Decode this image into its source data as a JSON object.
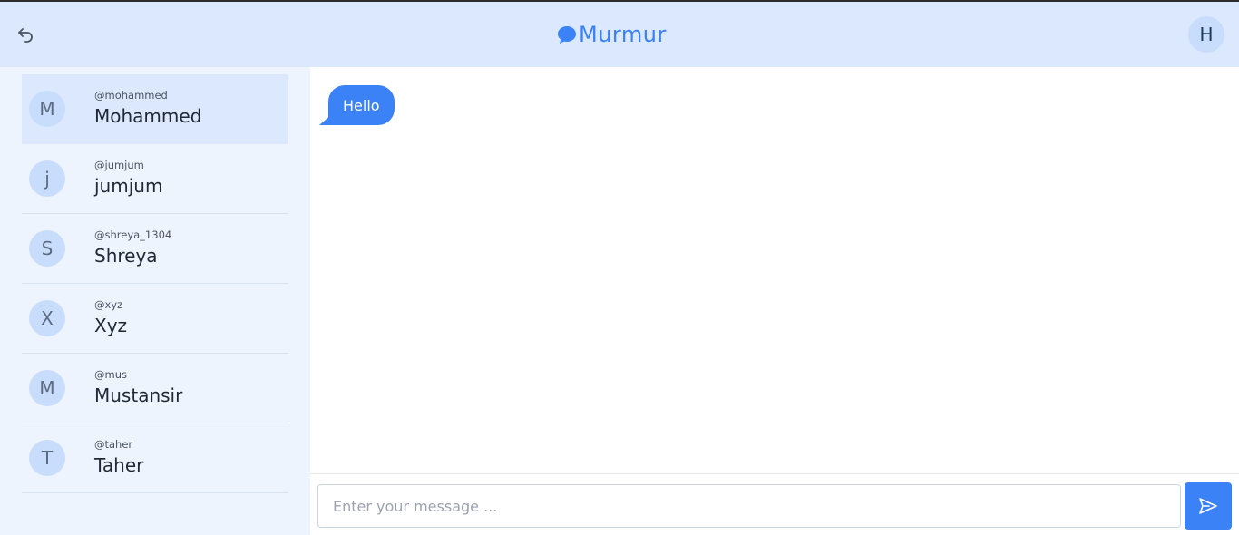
{
  "header": {
    "brand": "Murmur",
    "user_initial": "H"
  },
  "icons": {
    "back": "back-arrow-icon",
    "brand": "chat-bubble-icon",
    "send": "send-icon"
  },
  "colors": {
    "accent": "#3b82f6",
    "header_bg": "#dbe8fd",
    "sidebar_bg": "#eef4fe"
  },
  "contacts": [
    {
      "initial": "M",
      "handle": "@mohammed",
      "name": "Mohammed",
      "active": true
    },
    {
      "initial": "j",
      "handle": "@jumjum",
      "name": "jumjum",
      "active": false
    },
    {
      "initial": "S",
      "handle": "@shreya_1304",
      "name": "Shreya",
      "active": false
    },
    {
      "initial": "X",
      "handle": "@xyz",
      "name": "Xyz",
      "active": false
    },
    {
      "initial": "M",
      "handle": "@mus",
      "name": "Mustansir",
      "active": false
    },
    {
      "initial": "T",
      "handle": "@taher",
      "name": "Taher",
      "active": false
    }
  ],
  "messages": [
    {
      "text": "Hello"
    }
  ],
  "composer": {
    "placeholder": "Enter your message ..."
  }
}
